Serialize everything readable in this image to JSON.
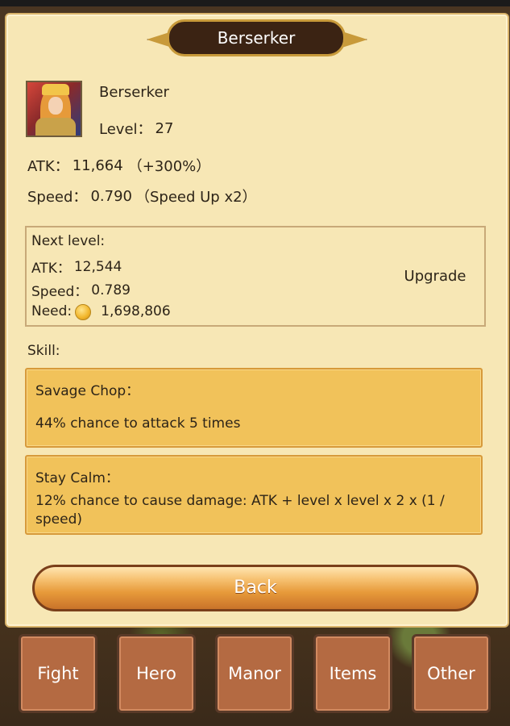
{
  "title": "Berserker",
  "hero": {
    "name": "Berserker",
    "level_label": "Level：",
    "level_value": "27"
  },
  "stats": {
    "atk_label": "ATK：",
    "atk_value": "11,664",
    "atk_bonus": "（+300%）",
    "speed_label": "Speed：",
    "speed_value": "0.790",
    "speed_bonus": "（Speed Up x2）"
  },
  "next_level": {
    "heading": "Next level:",
    "atk_label": "ATK：",
    "atk_value": "12,544",
    "speed_label": "Speed：",
    "speed_value": "0.789",
    "need_label": "Need:",
    "need_value": "1,698,806",
    "upgrade_label": "Upgrade",
    "need_icon": "gold-coin-icon"
  },
  "skill_heading": "Skill:",
  "skills": [
    {
      "title": "Savage Chop：",
      "desc": "44% chance to attack 5 times"
    },
    {
      "title": "Stay Calm：",
      "desc": "12% chance to cause damage: ATK + level x level x 2 x (1 / speed)"
    }
  ],
  "back_label": "Back",
  "tabs": [
    "Fight",
    "Hero",
    "Manor",
    "Items",
    "Other"
  ],
  "colors": {
    "panel_bg": "#f7e7b5",
    "skill_bg": "#f1c25a",
    "tab_bg": "#b46a42",
    "title_plate": "#3b2313"
  }
}
